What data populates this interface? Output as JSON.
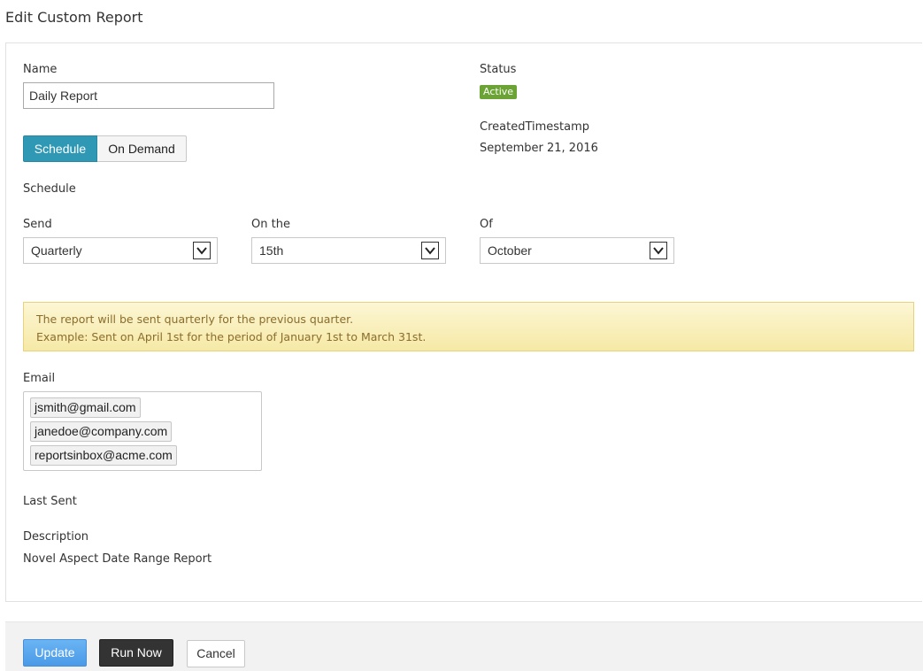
{
  "page": {
    "title": "Edit Custom Report"
  },
  "form": {
    "name_label": "Name",
    "name_value": "Daily Report",
    "status_label": "Status",
    "status_value": "Active",
    "created_label": "CreatedTimestamp",
    "created_value": "September 21, 2016",
    "mode_toggle": {
      "schedule": "Schedule",
      "on_demand": "On Demand",
      "selected": "Schedule"
    },
    "schedule_label": "Schedule",
    "send_label": "Send",
    "send_value": "Quarterly",
    "on_the_label": "On the",
    "on_the_value": "15th",
    "of_label": "Of",
    "of_value": "October",
    "info": {
      "line1": "The report will be sent quarterly for the previous quarter.",
      "line2": "Example: Sent on April 1st for the period of January 1st to March 31st."
    },
    "email_label": "Email",
    "emails": [
      "jsmith@gmail.com",
      "janedoe@company.com",
      "reportsinbox@acme.com"
    ],
    "last_sent_label": "Last Sent",
    "description_label": "Description",
    "description_value": "Novel Aspect Date Range Report"
  },
  "footer": {
    "update": "Update",
    "run_now": "Run Now",
    "cancel": "Cancel"
  },
  "icons": {
    "dropdown": "chevron-down-icon"
  },
  "colors": {
    "accent": "#2f98b4",
    "status_active": "#6ba434",
    "update_button": "#4a9ae8",
    "run_now_button": "#333333",
    "info_background": "#f6e9a6",
    "info_text": "#8a6d2c"
  }
}
